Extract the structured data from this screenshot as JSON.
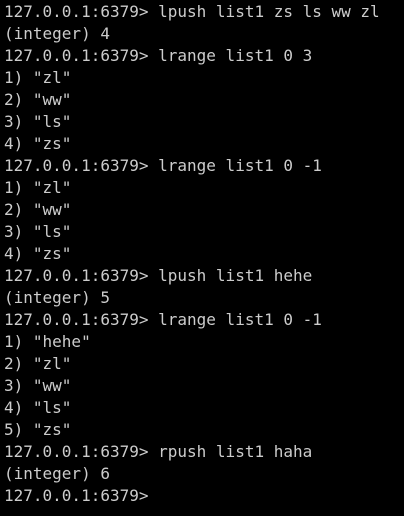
{
  "terminal": {
    "lines": [
      "127.0.0.1:6379> lpush list1 zs ls ww zl",
      "(integer) 4",
      "127.0.0.1:6379> lrange list1 0 3",
      "1) \"zl\"",
      "2) \"ww\"",
      "3) \"ls\"",
      "4) \"zs\"",
      "127.0.0.1:6379> lrange list1 0 -1",
      "1) \"zl\"",
      "2) \"ww\"",
      "3) \"ls\"",
      "4) \"zs\"",
      "127.0.0.1:6379> lpush list1 hehe",
      "(integer) 5",
      "127.0.0.1:6379> lrange list1 0 -1",
      "1) \"hehe\"",
      "2) \"zl\"",
      "3) \"ww\"",
      "4) \"ls\"",
      "5) \"zs\"",
      "127.0.0.1:6379> rpush list1 haha",
      "(integer) 6",
      "127.0.0.1:6379>"
    ]
  }
}
